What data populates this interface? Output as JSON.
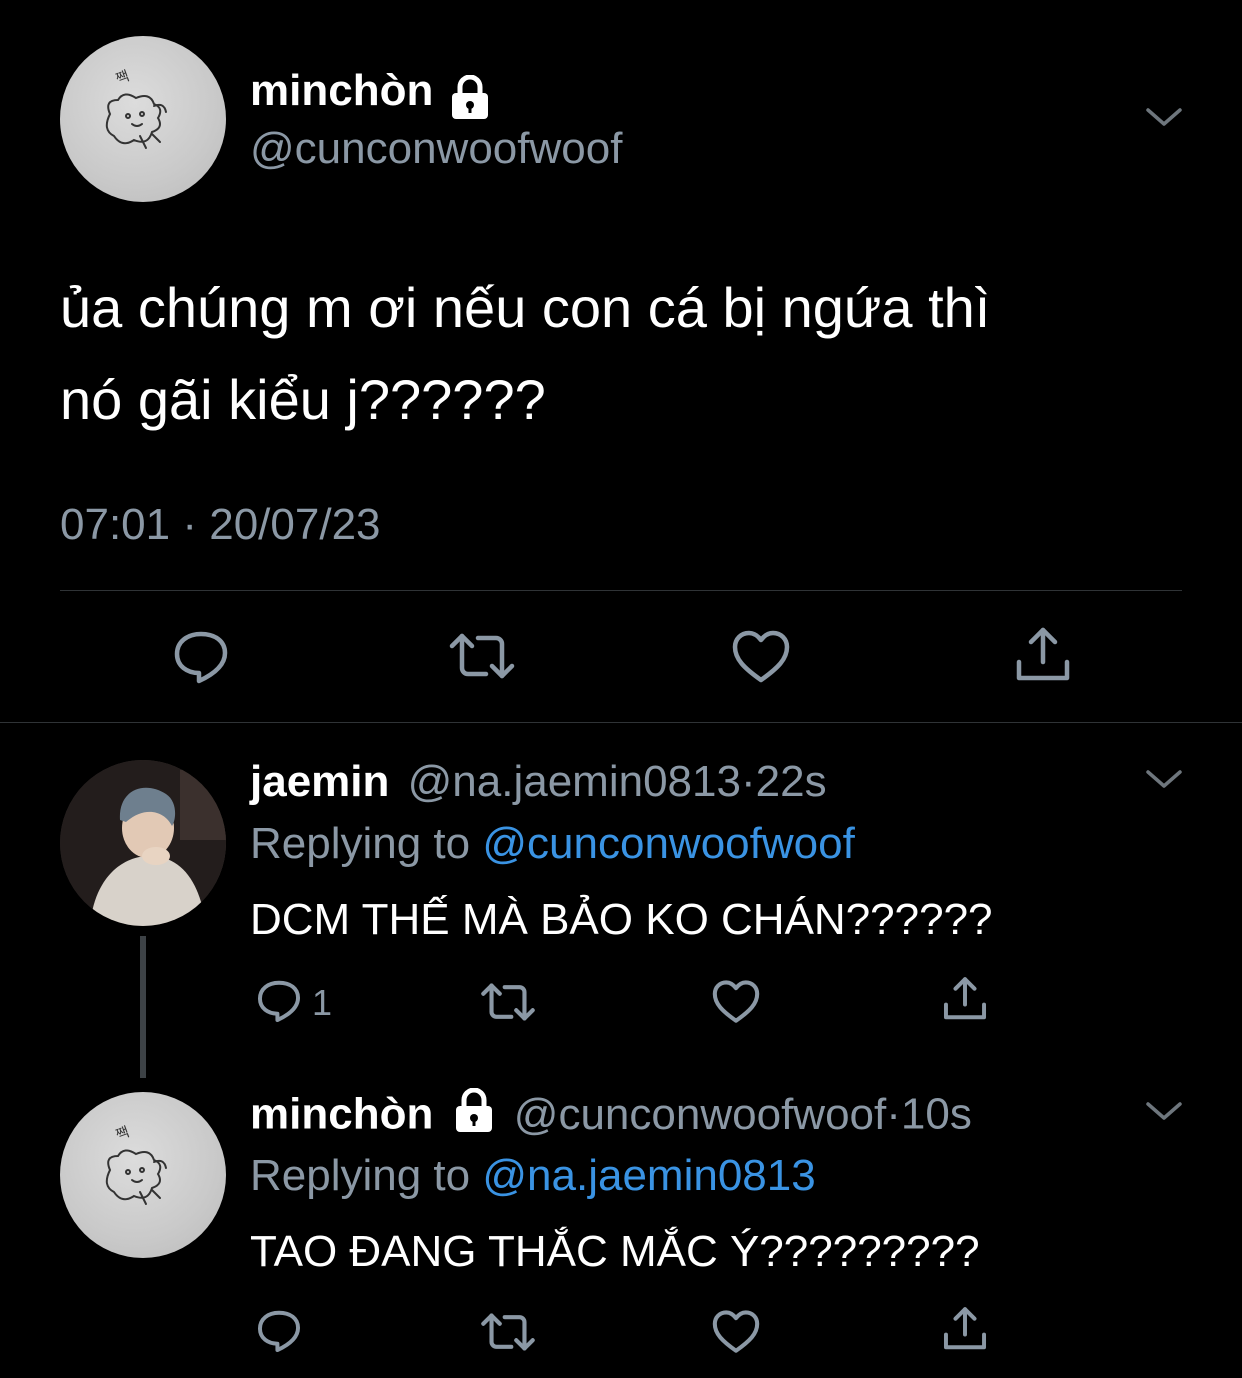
{
  "main_tweet": {
    "display_name": "minchòn",
    "handle": "@cunconwoofwoof",
    "text_line1": "ủa chúng m ơi nếu con cá bị ngứa thì",
    "text_line2": "nó gãi kiểu j??????",
    "time": "07:01",
    "separator": "·",
    "date": "20/07/23",
    "avatar_doodle_text": "짹"
  },
  "replies": [
    {
      "display_name": "jaemin",
      "handle": "@na.jaemin0813",
      "age": "·22s",
      "replying_label": "Replying to",
      "replying_handle": "@cunconwoofwoof",
      "text": "DCM THẾ MÀ BẢO KO CHÁN??????",
      "reply_count": "1"
    },
    {
      "display_name": "minchòn",
      "handle": "@cunconwoofwoof",
      "age": "·10s",
      "replying_label": "Replying to",
      "replying_handle": "@na.jaemin0813",
      "text": "TAO ĐANG THẮC MẮC Ý?????????",
      "reply_count": ""
    }
  ],
  "icons": {
    "reply": "reply-icon",
    "retweet": "retweet-icon",
    "like": "heart-icon",
    "share": "share-icon",
    "more": "chevron-down-icon",
    "lock": "lock-icon"
  },
  "colors": {
    "background": "#000000",
    "text": "#ffffff",
    "muted": "#8b98a5",
    "link": "#3a93e3",
    "divider": "#2f3336"
  }
}
